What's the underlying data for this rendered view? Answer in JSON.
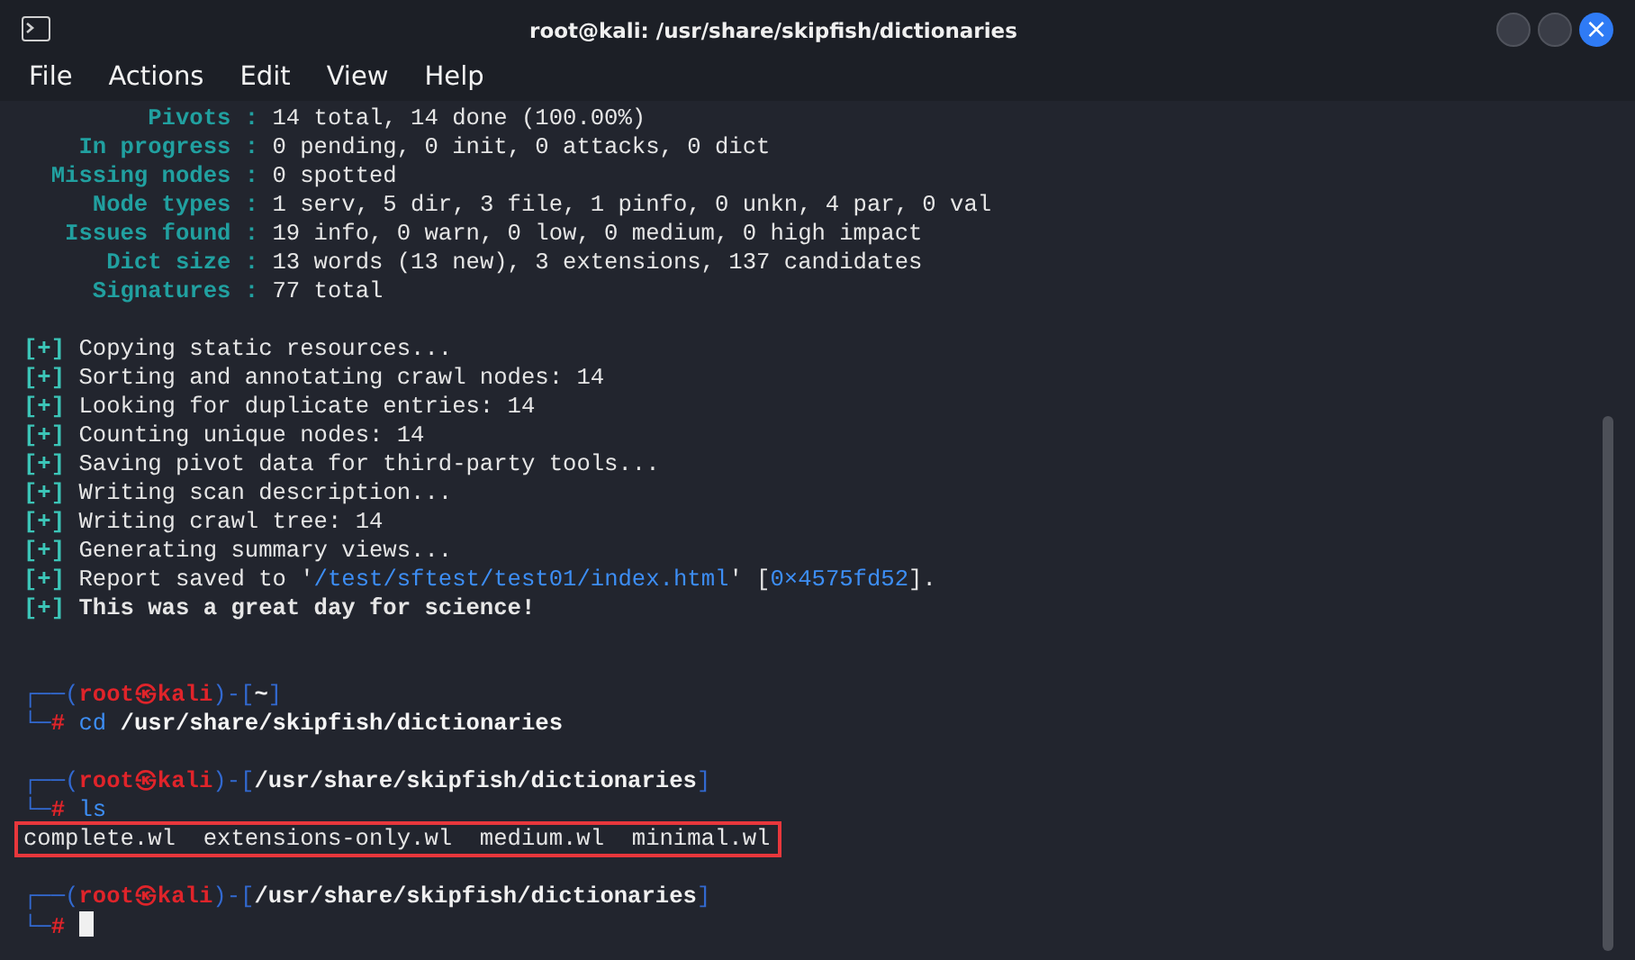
{
  "window": {
    "title": "root@kali: /usr/share/skipfish/dictionaries",
    "close_glyph": "×"
  },
  "menu": [
    "File",
    "Actions",
    "Edit",
    "View",
    "Help"
  ],
  "stats": [
    {
      "label": "Pivots",
      "sep": ":",
      "value": "14 total, 14 done (100.00%)"
    },
    {
      "label": "In progress",
      "sep": ":",
      "value": "0 pending, 0 init, 0 attacks, 0 dict"
    },
    {
      "label": "Missing nodes",
      "sep": ":",
      "value": "0 spotted"
    },
    {
      "label": "Node types",
      "sep": ":",
      "value": "1 serv, 5 dir, 3 file, 1 pinfo, 0 unkn, 4 par, 0 val"
    },
    {
      "label": "Issues found",
      "sep": ":",
      "value": "19 info, 0 warn, 0 low, 0 medium, 0 high impact"
    },
    {
      "label": "Dict size",
      "sep": ":",
      "value": "13 words (13 new), 3 extensions, 137 candidates"
    },
    {
      "label": "Signatures",
      "sep": ":",
      "value": "77 total"
    }
  ],
  "log": [
    {
      "tag": "[+]",
      "segments": [
        {
          "kind": "plain",
          "text": "Copying static resources..."
        }
      ]
    },
    {
      "tag": "[+]",
      "segments": [
        {
          "kind": "plain",
          "text": "Sorting and annotating crawl nodes: 14"
        }
      ]
    },
    {
      "tag": "[+]",
      "segments": [
        {
          "kind": "plain",
          "text": "Looking for duplicate entries: 14"
        }
      ]
    },
    {
      "tag": "[+]",
      "segments": [
        {
          "kind": "plain",
          "text": "Counting unique nodes: 14"
        }
      ]
    },
    {
      "tag": "[+]",
      "segments": [
        {
          "kind": "plain",
          "text": "Saving pivot data for third-party tools..."
        }
      ]
    },
    {
      "tag": "[+]",
      "segments": [
        {
          "kind": "plain",
          "text": "Writing scan description..."
        }
      ]
    },
    {
      "tag": "[+]",
      "segments": [
        {
          "kind": "plain",
          "text": "Writing crawl tree: 14"
        }
      ]
    },
    {
      "tag": "[+]",
      "segments": [
        {
          "kind": "plain",
          "text": "Generating summary views..."
        }
      ]
    },
    {
      "tag": "[+]",
      "segments": [
        {
          "kind": "plain",
          "text": "Report saved to '"
        },
        {
          "kind": "link",
          "text": "/test/sftest/test01/index.html"
        },
        {
          "kind": "plain",
          "text": "' ["
        },
        {
          "kind": "link",
          "text": "0×4575fd52"
        },
        {
          "kind": "plain",
          "text": "]."
        }
      ]
    },
    {
      "tag": "[+]",
      "segments": [
        {
          "kind": "bold",
          "text": "This was a great day for science!"
        }
      ]
    }
  ],
  "prompts": [
    {
      "top": "┌──(",
      "user": "root",
      "at": "㉿",
      "host": "kali",
      "mid": ")-[",
      "dir": "~",
      "close": "]",
      "bottom": "└─",
      "hash": "#",
      "command": "cd",
      "args": "/usr/share/skipfish/dictionaries"
    },
    {
      "top": "┌──(",
      "user": "root",
      "at": "㉿",
      "host": "kali",
      "mid": ")-[",
      "dir": "/usr/share/skipfish/dictionaries",
      "close": "]",
      "bottom": "└─",
      "hash": "#",
      "command": "ls",
      "output": {
        "files": [
          "complete.wl",
          "extensions-only.wl",
          "medium.wl",
          "minimal.wl"
        ],
        "highlighted": true
      }
    },
    {
      "top": "┌──(",
      "user": "root",
      "at": "㉿",
      "host": "kali",
      "mid": ")-[",
      "dir": "/usr/share/skipfish/dictionaries",
      "close": "]",
      "bottom": "└─",
      "hash": "#",
      "cursor": true
    }
  ]
}
